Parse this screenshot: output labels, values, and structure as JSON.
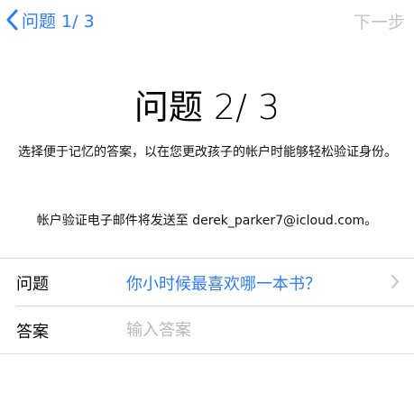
{
  "nav": {
    "back_label": "问题 1/ 3",
    "next_label": "下一步"
  },
  "main": {
    "title": "问题 2/ 3",
    "description": "选择便于记忆的答案，以在您更改孩子的帐户时能够轻松验证身份。",
    "email_note": "帐户验证电子邮件将发送至 derek_parker7@icloud.com。"
  },
  "form": {
    "question_label": "问题",
    "question_value": "你小时候最喜欢哪一本书？",
    "answer_label": "答案",
    "answer_placeholder": "输入答案",
    "answer_value": ""
  },
  "colors": {
    "accent": "#2f7cf6",
    "disabled": "#c2c2c7",
    "separator": "#d9d9de"
  },
  "icons": {
    "back": "chevron-left-icon",
    "row_disclosure": "chevron-right-icon"
  }
}
